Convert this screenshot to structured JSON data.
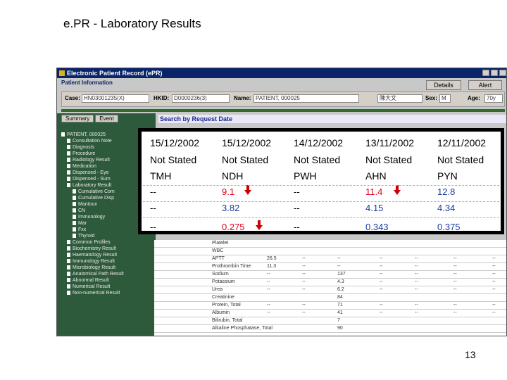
{
  "slide": {
    "title": "e.PR - Laboratory Results",
    "page_number": "13"
  },
  "window": {
    "title": "Electronic Patient Record (ePR)",
    "section": "Patient Information",
    "details_button": "Details",
    "alert_button": "Alert",
    "fields": {
      "case_label": "Case:",
      "case_value": "HN03001235(X)",
      "hkid_label": "HKID:",
      "hkid_value": "D0000236(3)",
      "name_label": "Name:",
      "name_value": "PATIENT, 000025",
      "chinese_value": "陳大文",
      "sex_label": "Sex:",
      "sex_value": "M",
      "age_label": "Age:",
      "age_value": "70y"
    },
    "tabs": [
      "Summary",
      "Event"
    ],
    "search_label": "Search by Request Date"
  },
  "tree": [
    "PATIENT, 000025",
    "Consultation Note",
    "Diagnosis",
    "Procedure",
    "Radiology Result",
    "Medication",
    "Dispensed - Eye",
    "Dispensed - Sum",
    "Laboratory Result",
    "Cumulative Com",
    "Cumulative Disp",
    "Mantoux",
    "CN",
    "Immunology",
    "Mar",
    "Fxx",
    "Thyroid",
    "Common Profiles",
    "Biochemistry Result",
    "Haematology Result",
    "Immunology Result",
    "Microbiology Result",
    "Anatomical Path Result",
    "Abnormal Result",
    "Numerical Result",
    "Non-numerical Result"
  ],
  "grid_rows": [
    {
      "label": "Platelet",
      "v": [
        "",
        "",
        "",
        "",
        "",
        "",
        "",
        ""
      ]
    },
    {
      "label": "WBC",
      "v": [
        "",
        "",
        "",
        "",
        "",
        "",
        "",
        ""
      ]
    },
    {
      "label": "APTT",
      "v": [
        "",
        "26.5",
        "--",
        "--",
        "--",
        "--",
        "--",
        "--"
      ]
    },
    {
      "label": "Prothrombin Time",
      "v": [
        "",
        "11.3",
        "--",
        "--",
        "--",
        "--",
        "--",
        "--"
      ]
    },
    {
      "label": "Sodium",
      "v": [
        "",
        "--",
        "--",
        "137",
        "--",
        "--",
        "--",
        "--"
      ]
    },
    {
      "label": "Potassium",
      "v": [
        "",
        "--",
        "--",
        "4.3",
        "--",
        "--",
        "--",
        "--"
      ]
    },
    {
      "label": "Urea",
      "v": [
        "",
        "--",
        "--",
        "6.2",
        "--",
        "--",
        "--",
        "--"
      ]
    },
    {
      "label": "Creatinine",
      "v": [
        "",
        "",
        "",
        "84",
        "",
        "",
        "",
        ""
      ]
    },
    {
      "label": "Protein, Total",
      "v": [
        "",
        "--",
        "--",
        "71",
        "--",
        "--",
        "--",
        "--"
      ]
    },
    {
      "label": "Albumin",
      "v": [
        "",
        "--",
        "--",
        "41",
        "--",
        "--",
        "--",
        "--"
      ]
    },
    {
      "label": "Bilirubin, Total",
      "v": [
        "",
        "",
        "",
        "7",
        "",
        "",
        "",
        ""
      ]
    },
    {
      "label": "Alkaline Phosphatase, Total",
      "v": [
        "",
        "",
        "",
        "90",
        "",
        "",
        "",
        ""
      ]
    }
  ],
  "overlay": {
    "columns": [
      {
        "date": "15/12/2002",
        "status": "Not Stated",
        "hospital": "TMH",
        "r1": "--",
        "r2": "--",
        "r3": "--"
      },
      {
        "date": "15/12/2002",
        "status": "Not Stated",
        "hospital": "NDH",
        "r1": "9.1",
        "r2": "3.82",
        "r3": "0.275"
      },
      {
        "date": "14/12/2002",
        "status": "Not Stated",
        "hospital": "PWH",
        "r1": "--",
        "r2": "--",
        "r3": "--"
      },
      {
        "date": "13/11/2002",
        "status": "Not Stated",
        "hospital": "AHN",
        "r1": "11.4",
        "r2": "4.15",
        "r3": "0.343"
      },
      {
        "date": "12/11/2002",
        "status": "Not Stated",
        "hospital": "PYN",
        "r1": "12.8",
        "r2": "4.34",
        "r3": "0.375"
      }
    ],
    "colors": {
      "abnormal": "#e0001b",
      "normal_blue": "#1c3c9c",
      "arrow": "#cc0000"
    }
  }
}
